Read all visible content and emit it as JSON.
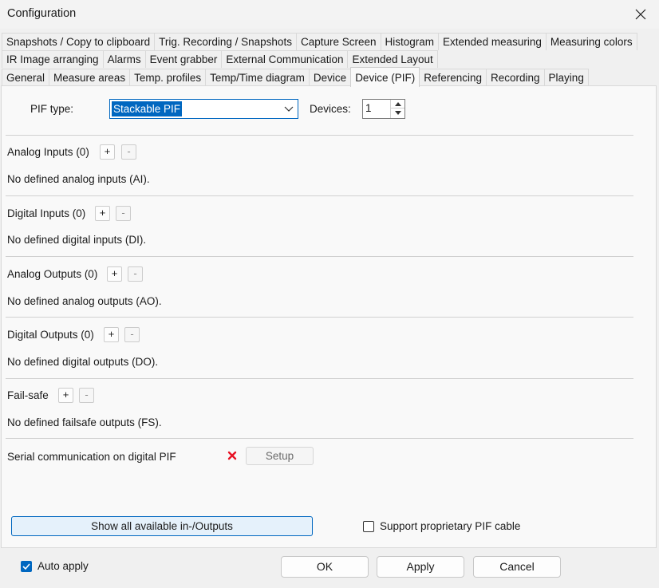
{
  "window": {
    "title": "Configuration"
  },
  "tabs": {
    "row1": [
      "Snapshots / Copy to clipboard",
      "Trig. Recording / Snapshots",
      "Capture Screen",
      "Histogram",
      "Extended measuring",
      "Measuring colors"
    ],
    "row2": [
      "IR Image arranging",
      "Alarms",
      "Event grabber",
      "External Communication",
      "Extended Layout"
    ],
    "row3": [
      "General",
      "Measure areas",
      "Temp. profiles",
      "Temp/Time diagram",
      "Device",
      "Device (PIF)",
      "Referencing",
      "Recording",
      "Playing"
    ],
    "active": "Device (PIF)"
  },
  "pif": {
    "type_label": "PIF type:",
    "type_value": "Stackable PIF",
    "devices_label": "Devices:",
    "devices_value": "1"
  },
  "sections": {
    "analog_inputs": {
      "title": "Analog Inputs (0)",
      "empty": "No defined analog inputs (AI)."
    },
    "digital_inputs": {
      "title": "Digital Inputs (0)",
      "empty": "No defined digital inputs (DI)."
    },
    "analog_outputs": {
      "title": "Analog Outputs (0)",
      "empty": "No defined analog outputs (AO)."
    },
    "digital_outputs": {
      "title": "Digital Outputs (0)",
      "empty": "No defined digital outputs (DO)."
    },
    "failsafe": {
      "title": "Fail-safe",
      "empty": "No defined failsafe outputs (FS)."
    },
    "add_label": "+",
    "remove_label": "-"
  },
  "serial": {
    "label": "Serial communication on digital PIF",
    "setup_label": "Setup",
    "status_color": "#e81123"
  },
  "show_all_label": "Show all available in-/Outputs",
  "proprietary_cable": {
    "label": "Support proprietary PIF cable",
    "checked": false
  },
  "footer": {
    "auto_apply": {
      "label": "Auto apply",
      "checked": true
    },
    "ok_label": "OK",
    "apply_label": "Apply",
    "cancel_label": "Cancel"
  },
  "colors": {
    "accent": "#0067c0"
  }
}
